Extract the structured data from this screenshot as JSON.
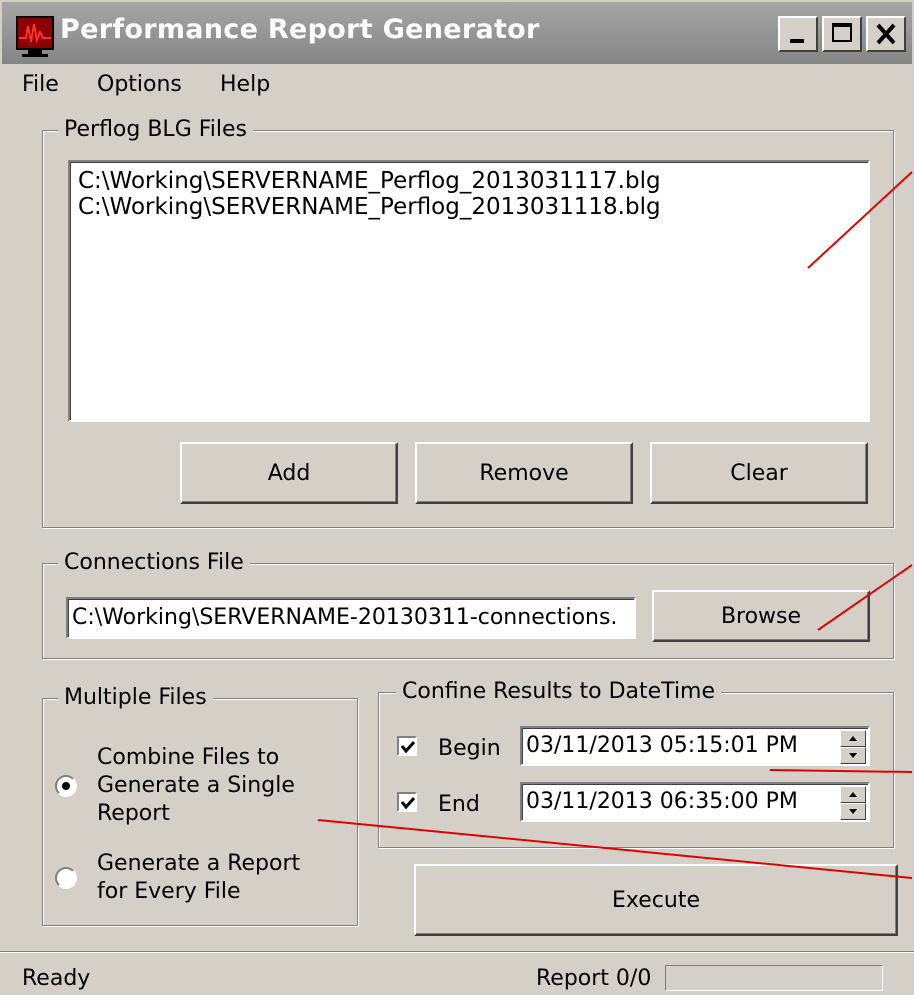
{
  "window": {
    "title": "Performance Report Generator",
    "titlebar_color": "#858585",
    "annotation_color": "#e00000"
  },
  "menu": {
    "file": "File",
    "options": "Options",
    "help": "Help"
  },
  "perflog": {
    "group_label": "Perflog BLG Files",
    "files": [
      "C:\\Working\\SERVERNAME_Perflog_2013031117.blg",
      "C:\\Working\\SERVERNAME_Perflog_2013031118.blg"
    ],
    "add_label": "Add",
    "remove_label": "Remove",
    "clear_label": "Clear"
  },
  "connections": {
    "group_label": "Connections File",
    "path_value": "C:\\Working\\SERVERNAME-20130311-connections.",
    "browse_label": "Browse"
  },
  "multiple_files": {
    "group_label": "Multiple Files",
    "option_combine": "Combine Files to Generate a Single Report",
    "option_every": "Generate a Report for Every File",
    "selected": "combine"
  },
  "datetime": {
    "group_label": "Confine Results to DateTime",
    "begin_label": "Begin",
    "begin_checked": true,
    "begin_value": "03/11/2013 05:15:01 PM",
    "end_label": "End",
    "end_checked": true,
    "end_value": "03/11/2013 06:35:00 PM"
  },
  "execute_label": "Execute",
  "status": {
    "text": "Ready",
    "report": "Report 0/0"
  }
}
